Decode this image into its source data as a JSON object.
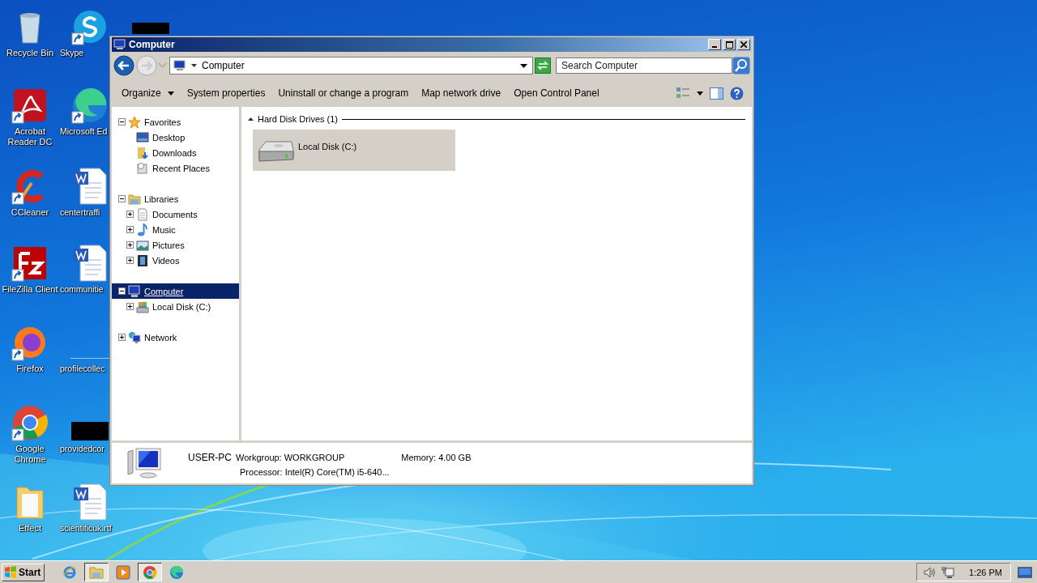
{
  "desktop_icons": [
    {
      "label": "Recycle Bin",
      "shortcut": false
    },
    {
      "label": "Acrobat Reader DC",
      "shortcut": true
    },
    {
      "label": "CCleaner",
      "shortcut": true
    },
    {
      "label": "FileZilla Client",
      "shortcut": true
    },
    {
      "label": "Firefox",
      "shortcut": true
    },
    {
      "label": "Google Chrome",
      "shortcut": true
    },
    {
      "label": "Effect",
      "shortcut": false
    },
    {
      "label": "Skype",
      "shortcut": true
    },
    {
      "label": "Microsoft Ed",
      "shortcut": true
    },
    {
      "label": "centertraffi",
      "shortcut": false
    },
    {
      "label": "communitie",
      "shortcut": false
    },
    {
      "label": "profilecollec",
      "shortcut": false
    },
    {
      "label": "providedcor",
      "shortcut": false
    },
    {
      "label": "scientificuk.rtf",
      "shortcut": false
    }
  ],
  "window": {
    "title": "Computer"
  },
  "address_bar": {
    "location": "Computer"
  },
  "search": {
    "placeholder": "Search Computer"
  },
  "toolbar": [
    {
      "label": "Organize",
      "dropdown": true
    },
    {
      "label": "System properties",
      "dropdown": false
    },
    {
      "label": "Uninstall or change a program",
      "dropdown": false
    },
    {
      "label": "Map network drive",
      "dropdown": false
    },
    {
      "label": "Open Control Panel",
      "dropdown": false
    }
  ],
  "navigation": [
    {
      "label": "Favorites",
      "expanded": true,
      "selected": false,
      "children": [
        {
          "label": "Desktop",
          "selected": false
        },
        {
          "label": "Downloads",
          "selected": false
        },
        {
          "label": "Recent Places",
          "selected": false
        }
      ]
    },
    {
      "label": "Libraries",
      "expanded": true,
      "selected": false,
      "children": [
        {
          "label": "Documents",
          "expanded": false,
          "selected": false
        },
        {
          "label": "Music",
          "expanded": false,
          "selected": false
        },
        {
          "label": "Pictures",
          "expanded": false,
          "selected": false
        },
        {
          "label": "Videos",
          "expanded": false,
          "selected": false
        }
      ]
    },
    {
      "label": "Computer",
      "expanded": true,
      "selected": true,
      "children": [
        {
          "label": "Local Disk (C:)",
          "expanded": false,
          "selected": false
        }
      ]
    },
    {
      "label": "Network",
      "expanded": false,
      "selected": false
    }
  ],
  "content": {
    "group": {
      "title": "Hard Disk Drives (1)",
      "expanded": true
    },
    "items": [
      {
        "label": "Local Disk (C:)",
        "selected": true
      }
    ]
  },
  "details": {
    "name": "USER-PC",
    "workgroup": "Workgroup: WORKGROUP",
    "memory": "Memory: 4.00 GB",
    "processor": "Processor: Intel(R) Core(TM) i5-640..."
  },
  "taskbar": {
    "start": "Start",
    "apps": [
      {
        "active": false
      },
      {
        "active": true
      },
      {
        "active": false
      },
      {
        "active": true
      },
      {
        "active": false
      }
    ],
    "clock": "1:26 PM"
  }
}
